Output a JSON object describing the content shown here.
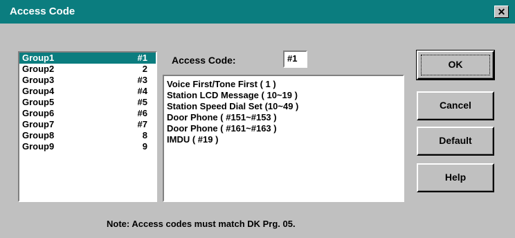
{
  "window": {
    "title": "Access Code",
    "close_icon": "close-icon",
    "close_glyph": "✕"
  },
  "colors": {
    "titlebar": "#0b7d7f",
    "selection": "#0b7d7f",
    "face": "#c0c0c0"
  },
  "groups": [
    {
      "name": "Group1",
      "code": "#1"
    },
    {
      "name": "Group2",
      "code": "2"
    },
    {
      "name": "Group3",
      "code": "#3"
    },
    {
      "name": "Group4",
      "code": "#4"
    },
    {
      "name": "Group5",
      "code": "#5"
    },
    {
      "name": "Group6",
      "code": "#6"
    },
    {
      "name": "Group7",
      "code": "#7"
    },
    {
      "name": "Group8",
      "code": "8"
    },
    {
      "name": "Group9",
      "code": "9"
    }
  ],
  "selected_group": "Group1",
  "access_code": {
    "label": "Access Code:",
    "value": "#1"
  },
  "codes": [
    "Voice First/Tone First ( 1 )",
    "Station LCD Message ( 10~19 )",
    "Station Speed Dial Set (10~49 )",
    "Door Phone ( #151~#153 )",
    "Door Phone ( #161~#163 )",
    "IMDU ( #19 )"
  ],
  "buttons": {
    "ok": "OK",
    "cancel": "Cancel",
    "default": "Default",
    "help": "Help"
  },
  "note": "Note:  Access codes must match DK Prg. 05."
}
